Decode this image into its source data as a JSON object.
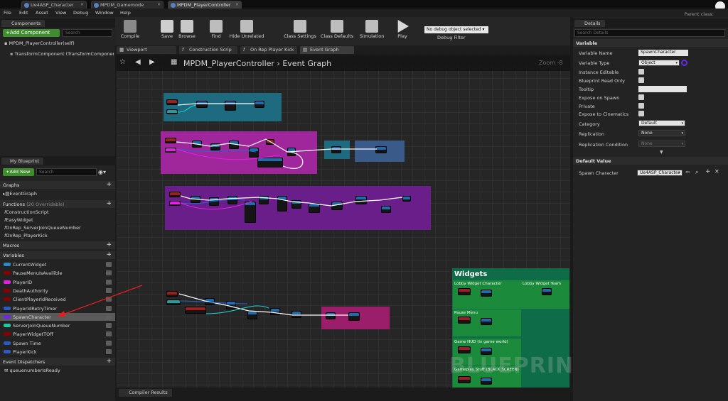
{
  "tabs": [
    {
      "label": "Ue4ASP_Character",
      "active": false
    },
    {
      "label": "MPDM_Gamemode",
      "active": false
    },
    {
      "label": "MPDM_PlayerController",
      "active": true
    }
  ],
  "parent_class": "Parent class:",
  "menu": [
    "File",
    "Edit",
    "Asset",
    "View",
    "Debug",
    "Window",
    "Help"
  ],
  "components": {
    "tab": "Components",
    "add_button": "+Add Component",
    "search_placeholder": "Search",
    "items": [
      "MPDM_PlayerController(self)",
      "TransformComponent (TransformComponent)"
    ]
  },
  "toolbar": {
    "buttons": [
      "Compile",
      "Save",
      "Browse",
      "Find",
      "Hide Unrelated",
      "Class Settings",
      "Class Defaults",
      "Simulation",
      "Play"
    ],
    "debug_object": "No debug object selected",
    "debug_filter": "Debug Filter"
  },
  "graph_tabs": [
    "Viewport",
    "Construction Scrip",
    "On Rep Player Kick",
    "Event Graph"
  ],
  "breadcrumb": {
    "title": "MPDM_PlayerController",
    "current": "Event Graph",
    "zoom": "Zoom -8"
  },
  "watermark": "BLUEPRINT",
  "widgets_comment": {
    "title": "Widgets",
    "subs": [
      "Lobby Widget Character",
      "Lobby Widget Team",
      "Pause Menu",
      "Game HUD (in game world)",
      "Gameplay Stuff (BLACK SCREEN)"
    ]
  },
  "my_blueprint": {
    "tab": "My Blueprint",
    "add_button": "+Add New",
    "search_placeholder": "Search",
    "graphs_header": "Graphs",
    "graphs": [
      "EventGraph"
    ],
    "functions_header": "Functions",
    "functions_note": "(20 Overridable)",
    "functions": [
      "ConstructionScript",
      "EasyWidget",
      "OnRep_ServerJoinQueueNumber",
      "OnRep_PlayerKick"
    ],
    "macros_header": "Macros",
    "variables_header": "Variables",
    "variables": [
      {
        "name": "CurrentWidget",
        "color": "#2a8ac4"
      },
      {
        "name": "PauseMenuIsAvailible",
        "color": "#8a0000"
      },
      {
        "name": "PlayerID",
        "color": "#e61ee6"
      },
      {
        "name": "DeathAuthority",
        "color": "#8a0000"
      },
      {
        "name": "ClientPlayerIdReceived",
        "color": "#8a0000"
      },
      {
        "name": "PlayerIdRetryTimer",
        "color": "#2a5ac4"
      },
      {
        "name": "SpawnCharacter",
        "color": "#6a2ae6"
      },
      {
        "name": "ServerJoinQueueNumber",
        "color": "#1ec8a0"
      },
      {
        "name": "PlayerWidgetTOff",
        "color": "#8a0000"
      },
      {
        "name": "Spawn Time",
        "color": "#2a5ac4"
      },
      {
        "name": "PlayerKick",
        "color": "#2a5ac4"
      }
    ],
    "dispatchers_header": "Event Dispatchers",
    "dispatchers": [
      "queuenumberIsReady"
    ]
  },
  "compiler_results": "Compiler Results",
  "details": {
    "tab": "Details",
    "search_placeholder": "Search Details",
    "section_variable": "Variable",
    "rows": [
      {
        "label": "Variable Name",
        "value": "SpawnCharacter"
      },
      {
        "label": "Variable Type",
        "value": "Object"
      },
      {
        "label": "Instance Editable"
      },
      {
        "label": "Blueprint Read Only"
      },
      {
        "label": "Tooltip"
      },
      {
        "label": "Expose on Spawn"
      },
      {
        "label": "Private"
      },
      {
        "label": "Expose to Cinematics"
      },
      {
        "label": "Category",
        "value": "Default"
      },
      {
        "label": "Replication",
        "value": "None"
      },
      {
        "label": "Replication Condition",
        "value": "None"
      }
    ],
    "section_default": "Default Value",
    "default_label": "Spawn Character",
    "default_value": "Ue4ASP_Character"
  }
}
